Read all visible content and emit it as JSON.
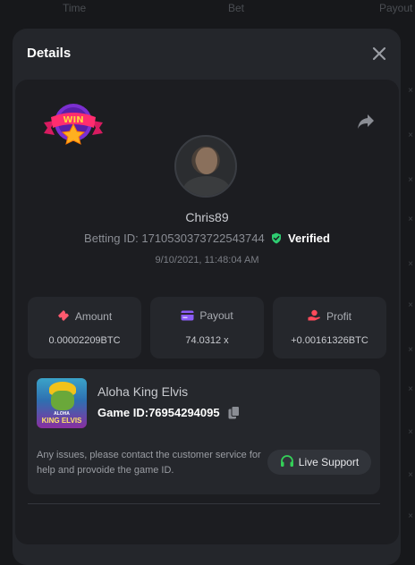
{
  "background": {
    "columns": [
      "Time",
      "Bet",
      "Payout"
    ],
    "multiplier_suffix": "×"
  },
  "modal": {
    "title": "Details",
    "username": "Chris89",
    "betting_id_label": "Betting ID: 1710530373722543744",
    "verified_label": "Verified",
    "timestamp": "9/10/2021, 11:48:04 AM",
    "badge_text": "WIN",
    "stats": [
      {
        "label": "Amount",
        "value": "0.00002209BTC",
        "icon": "ticket-icon",
        "color": "#ff5a6e"
      },
      {
        "label": "Payout",
        "value": "74.0312 x",
        "icon": "card-icon",
        "color": "#8b5cf6"
      },
      {
        "label": "Profit",
        "value": "+0.00161326BTC",
        "icon": "hand-coin-icon",
        "color": "#ff4a5a"
      }
    ],
    "game": {
      "name": "Aloha King Elvis",
      "id_label": "Game ID:76954294095",
      "thumb_line1": "ALOHA",
      "thumb_line2": "KING ELVIS"
    },
    "support_text": "Any issues, please contact the customer service for help and provoide the game ID.",
    "live_support_label": "Live Support"
  },
  "colors": {
    "verified_green": "#2ecc71",
    "headset_green": "#34d058"
  }
}
